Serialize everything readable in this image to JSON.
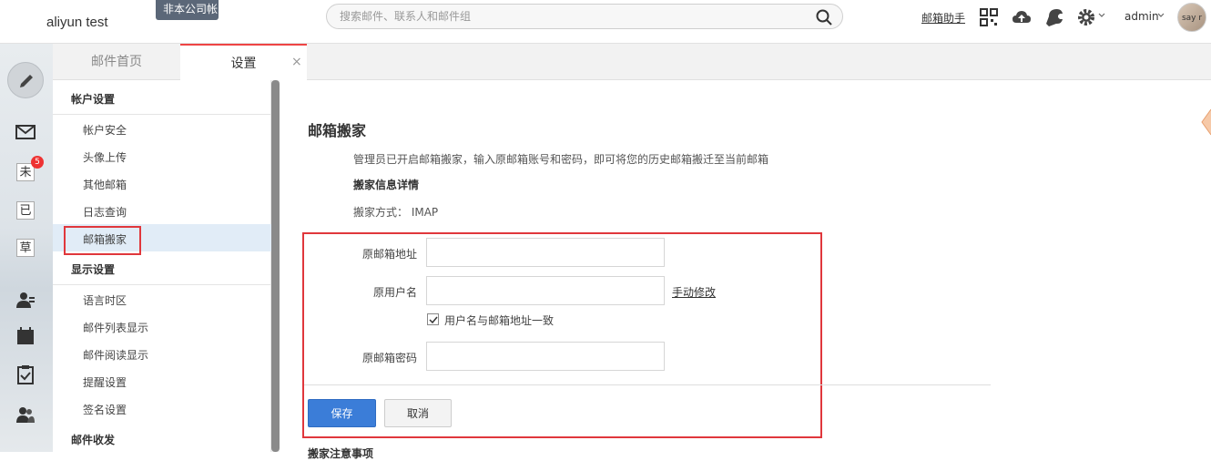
{
  "header": {
    "title": "aliyun test",
    "notice_tag": "非本公司帐",
    "search_placeholder": "搜索邮件、联系人和邮件组",
    "helper_link": "邮箱助手",
    "admin_label": "admin",
    "avatar_text": "say r"
  },
  "leftnav": {
    "unread_glyph": "未",
    "unread_count": "5",
    "sent_glyph": "已",
    "draft_glyph": "草"
  },
  "tabs": [
    {
      "label": "邮件首页"
    },
    {
      "label": "设置",
      "close": "×"
    }
  ],
  "settings_menu": {
    "groups": [
      {
        "title": "帐户设置",
        "items": [
          "帐户安全",
          "头像上传",
          "其他邮箱",
          "日志查询",
          "邮箱搬家"
        ]
      },
      {
        "title": "显示设置",
        "items": [
          "语言时区",
          "邮件列表显示",
          "邮件阅读显示",
          "提醒设置",
          "签名设置"
        ]
      },
      {
        "title": "邮件收发",
        "items": []
      }
    ]
  },
  "main": {
    "title": "邮箱搬家",
    "description": "管理员已开启邮箱搬家，输入原邮箱账号和密码，即可将您的历史邮箱搬迁至当前邮箱",
    "details_title": "搬家信息详情",
    "method": "搬家方式： IMAP",
    "form": {
      "address_label": "原邮箱地址",
      "username_label": "原用户名",
      "manual_link": "手动修改",
      "same_checkbox_label": "用户名与邮箱地址一致",
      "same_checked": true,
      "password_label": "原邮箱密码"
    },
    "save_label": "保存",
    "cancel_label": "取消",
    "notes_title": "搬家注意事项"
  }
}
